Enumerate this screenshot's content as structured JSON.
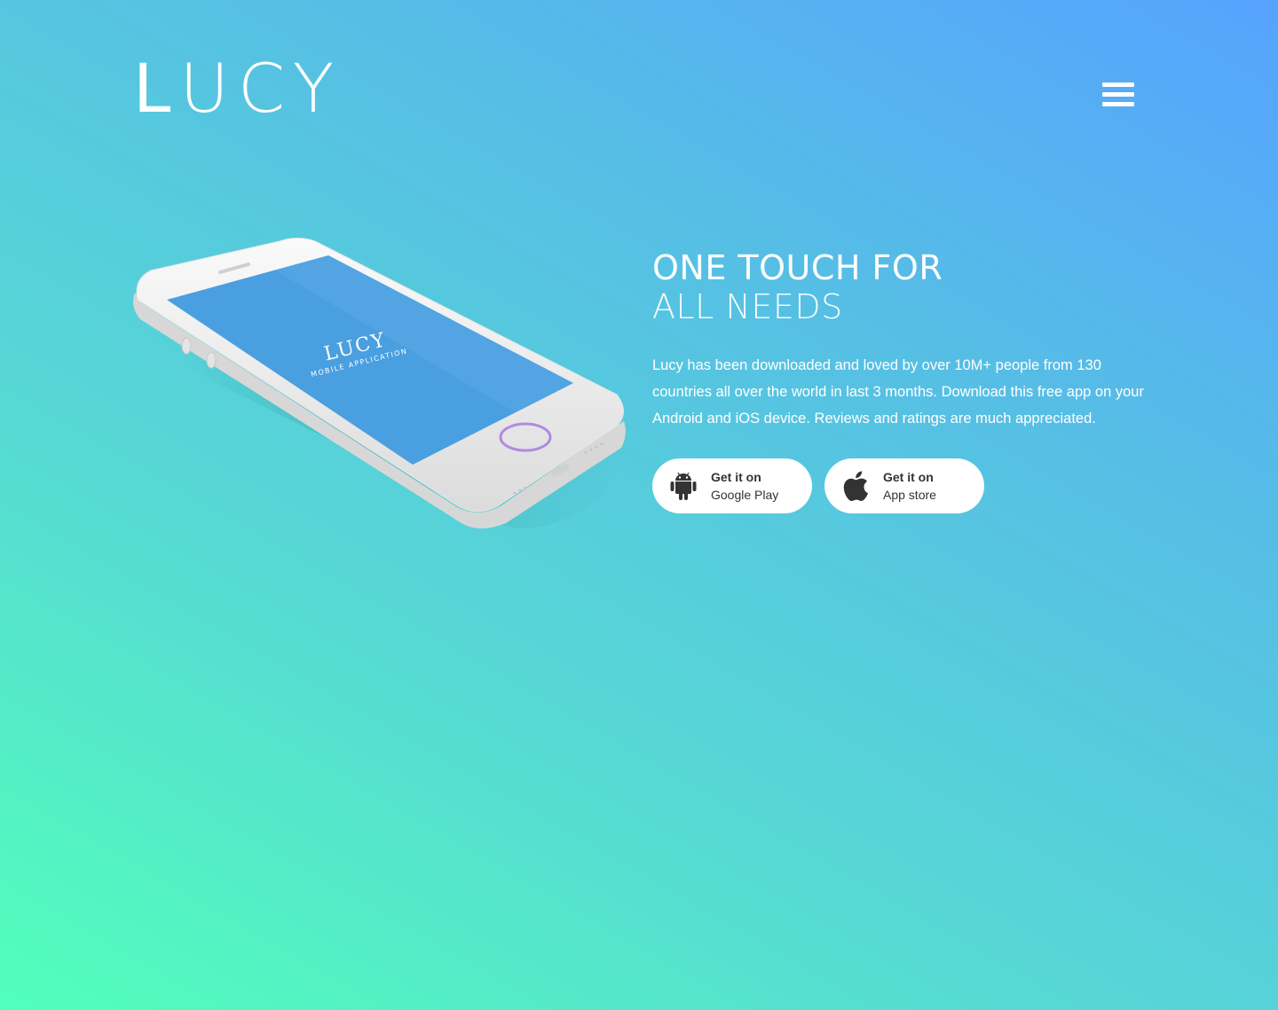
{
  "header": {
    "logo_first": "L",
    "logo_rest": "UCY"
  },
  "phone": {
    "screen_title": "LUCY",
    "screen_subtitle": "MOBILE APPLICATION"
  },
  "hero": {
    "headline_line1": "ONE TOUCH FOR",
    "headline_line2": "ALL NEEDS",
    "description": "Lucy has been downloaded and loved by over 10M+ people from 130 countries all over the world in last 3 months. Download this free app on your Android and iOS device. Reviews and ratings are much appreciated."
  },
  "buttons": {
    "google_play": {
      "line1": "Get it on",
      "line2": "Google Play",
      "icon": "android-icon"
    },
    "app_store": {
      "line1": "Get it on",
      "line2": "App store",
      "icon": "apple-icon"
    }
  },
  "colors": {
    "gradient_start": "#52ffbb",
    "gradient_end": "#56a3ff",
    "screen_blue": "#4a9fe0",
    "home_ring": "#b08ae0"
  }
}
